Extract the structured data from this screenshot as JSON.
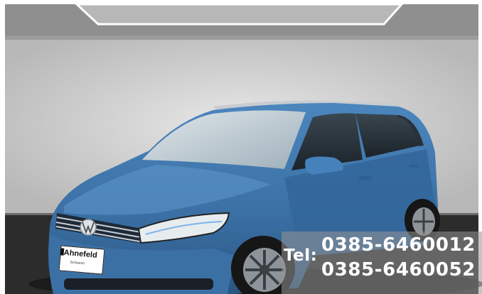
{
  "photo": {
    "subject": "blue-minivan",
    "colors": {
      "car_body": "#3f78ae",
      "wall": "#d6d6d6",
      "floor": "#2a2a2a",
      "overlay": "#9a9a9a"
    }
  },
  "dealer_plate": {
    "name": "Ahnefeld",
    "sub": "Schwerin"
  },
  "contact": {
    "tel_label": "Tel:",
    "phone_1": "0385-6460012",
    "phone_2": "0385-6460052"
  }
}
